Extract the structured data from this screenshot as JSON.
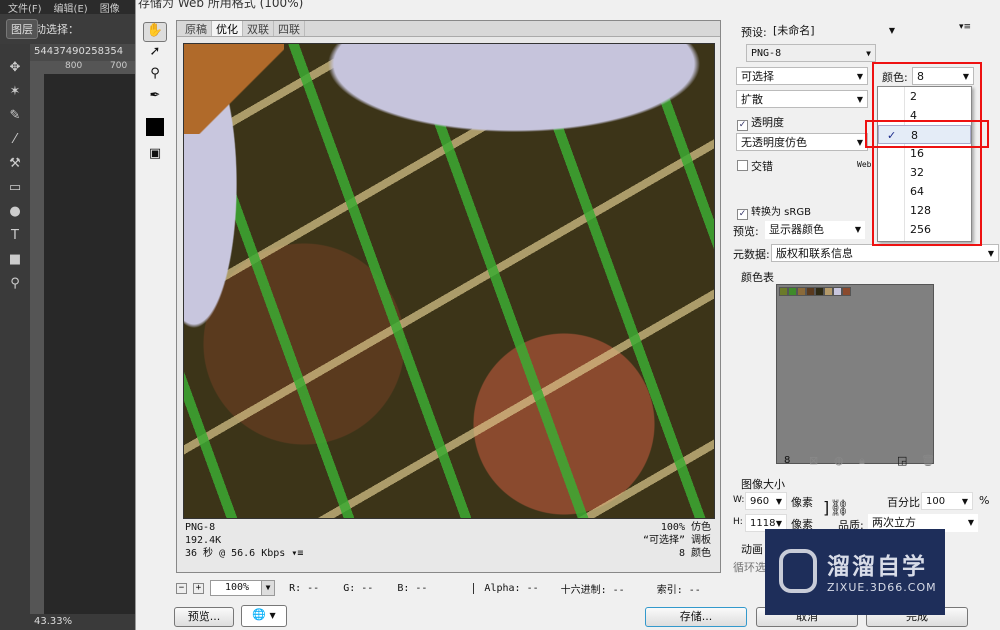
{
  "ps": {
    "menu": [
      "文件(F)",
      "编辑(E)",
      "图像"
    ],
    "auto_select": "自动选择：",
    "layer_btn": "图层",
    "doc_tab": "54437490258354",
    "ruler": [
      "800",
      "700"
    ],
    "zoom": "43.33%"
  },
  "dialog": {
    "title": "存储为 Web 所用格式 (100%)",
    "view_tabs": [
      "原稿",
      "优化",
      "双联",
      "四联"
    ],
    "info_left": [
      "PNG-8",
      "192.4K",
      "36 秒 @ 56.6 Kbps"
    ],
    "info_right": [
      "100% 仿色",
      "“可选择” 调板",
      "8 颜色"
    ],
    "zoom": "100%",
    "readouts": [
      "R: --",
      "G: --",
      "B: --",
      "Alpha: --",
      "十六进制: --",
      "索引: --"
    ],
    "preview_btn": "预览...",
    "save_btn": "存储...",
    "cancel_btn": "取消",
    "done_btn": "完成"
  },
  "settings": {
    "preset_label": "预设:",
    "preset": "[未命名]",
    "format": "PNG-8",
    "palette": "可选择",
    "dither": "扩散",
    "transparency": "透明度",
    "transparency_checked": true,
    "matte_dither": "无透明度仿色",
    "interlaced": "交错",
    "interlaced_checked": false,
    "web_snap": "Web",
    "colors_label": "颜色:",
    "colors_value": "8",
    "color_options": [
      "2",
      "4",
      "8",
      "16",
      "32",
      "64",
      "128",
      "256"
    ],
    "color_selected": "8",
    "convert_srgb": "转换为 sRGB",
    "convert_checked": true,
    "preview_label": "预览:",
    "preview_value": "显示器颜色",
    "metadata_label": "元数据:",
    "metadata_value": "版权和联系信息",
    "color_table_label": "颜色表",
    "color_table": [
      "#6b7a2a",
      "#3f8a2a",
      "#8a6a3a",
      "#5a3a1e",
      "#2e2a14",
      "#b49a6a",
      "#c8c6de",
      "#8a4a2e"
    ],
    "color_count": "8",
    "image_size_label": "图像大小",
    "w_label": "W:",
    "w": "960",
    "h_label": "H:",
    "h": "1118",
    "unit": "像素",
    "percent_label": "百分比:",
    "percent": "100",
    "percent_unit": "%",
    "quality_label": "品质:",
    "quality": "两次立方",
    "animation_label": "动画",
    "loop_label": "循环选"
  },
  "watermark": {
    "title": "溜溜自学",
    "url": "ZIXUE.3D66.COM"
  },
  "colors": {
    "highlight": "#e11111",
    "watermark_bg": "#1e2e5a"
  }
}
